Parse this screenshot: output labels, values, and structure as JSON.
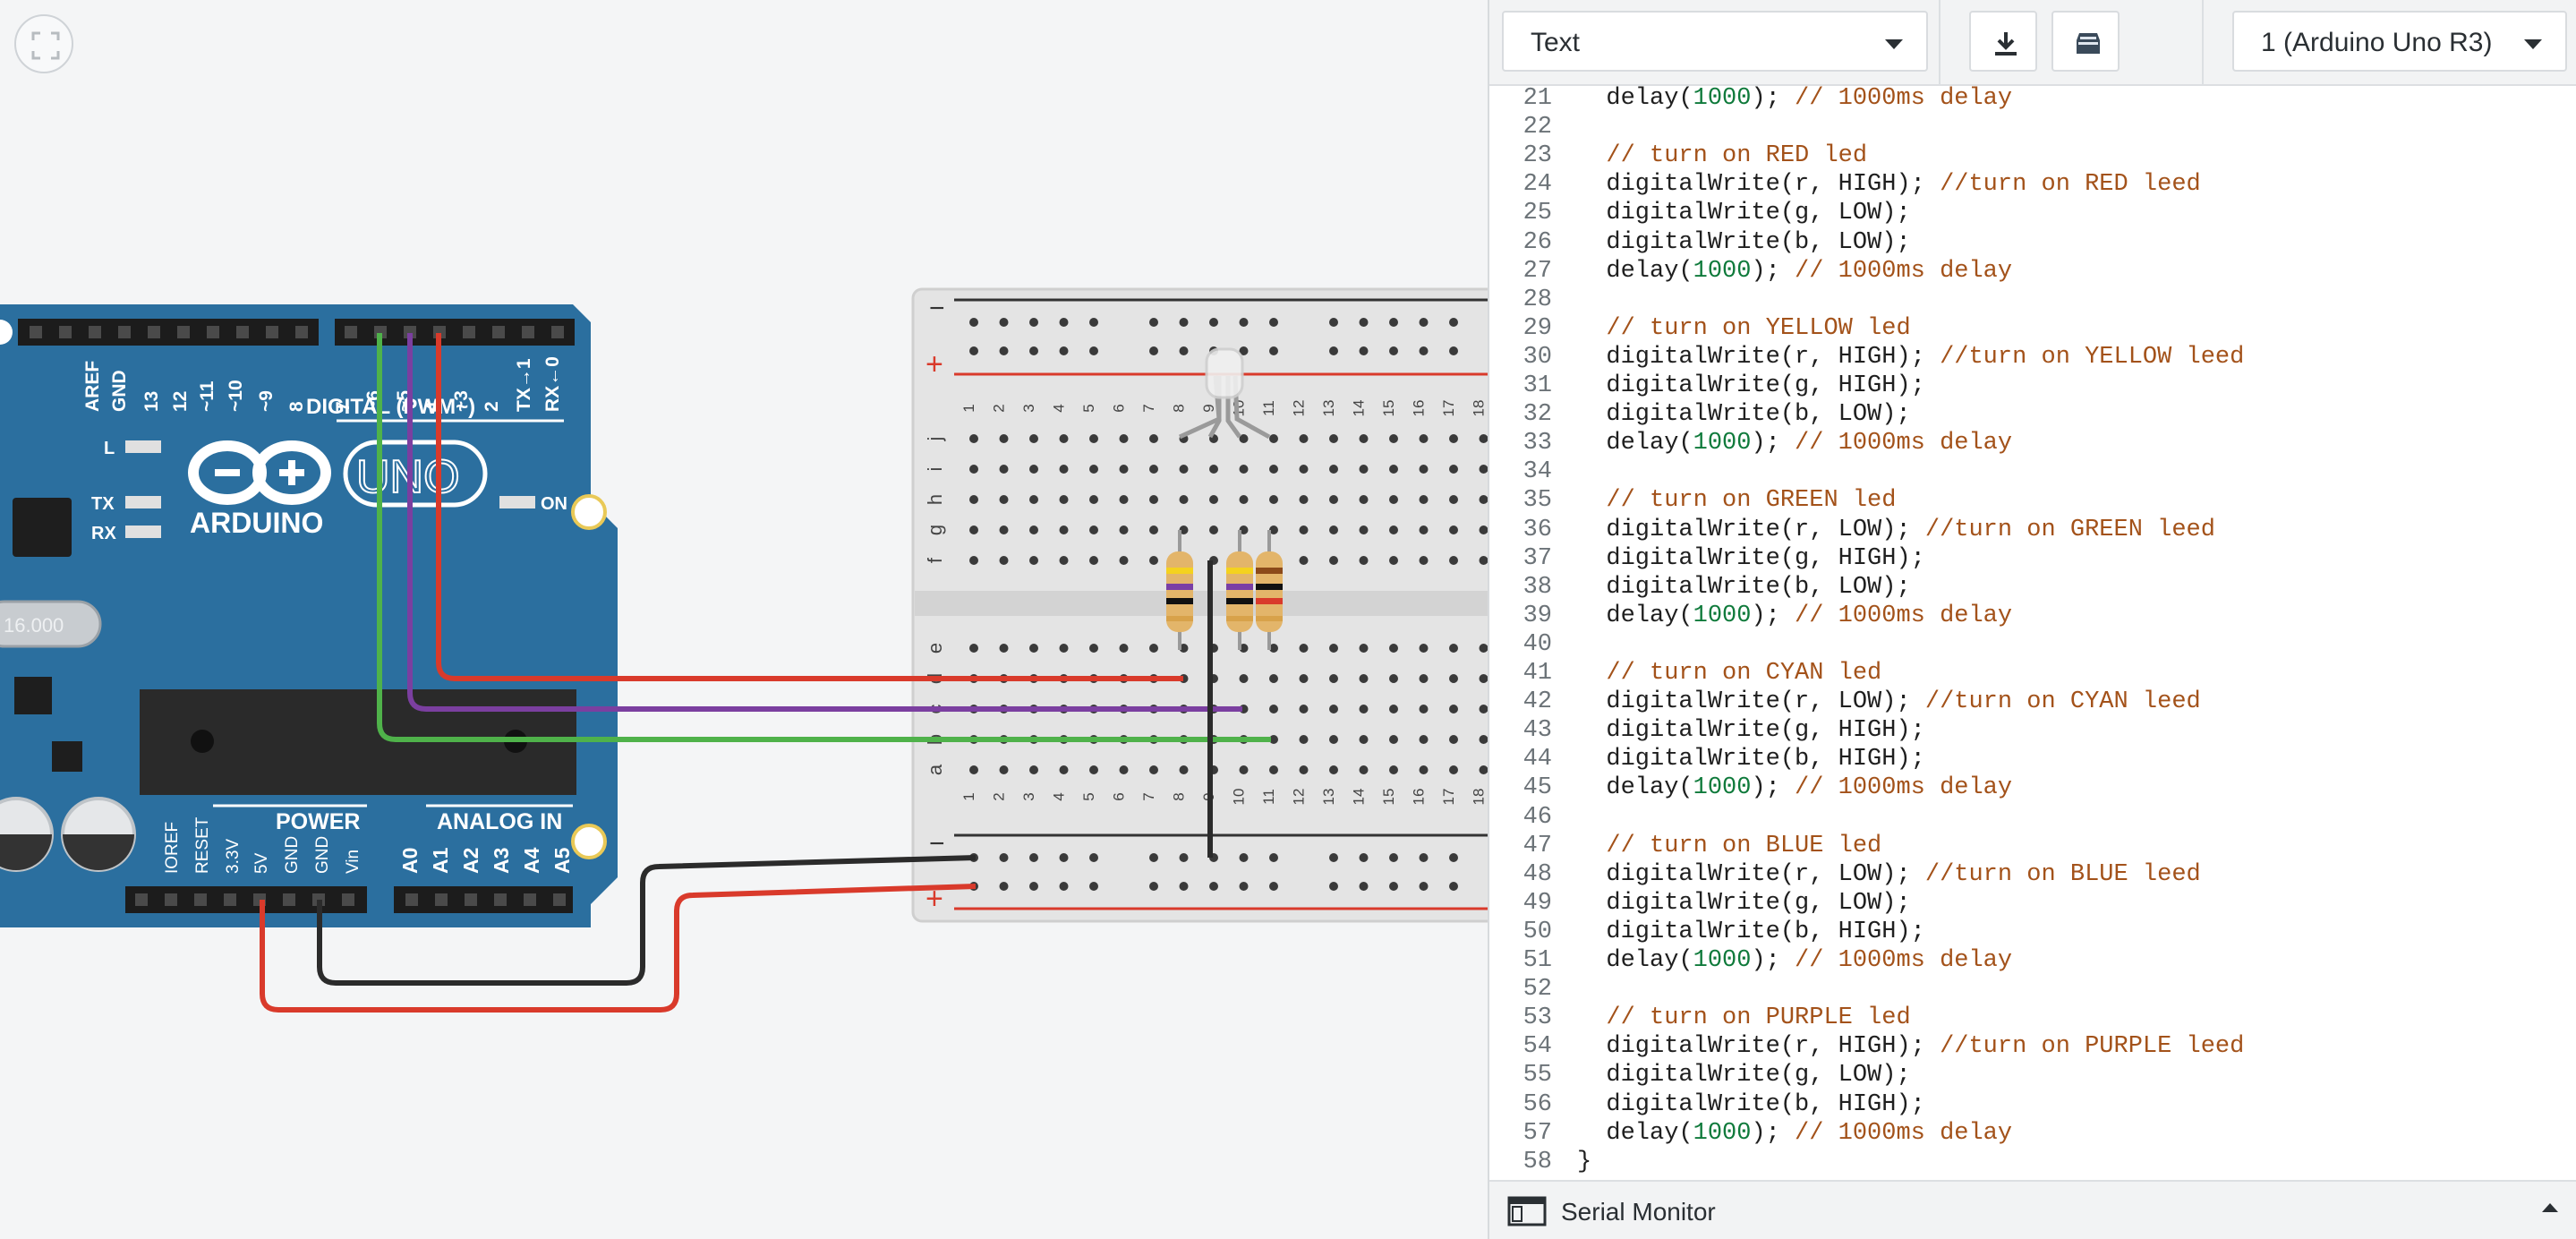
{
  "canvas": {
    "board": {
      "digital_header": [
        "AREF",
        "GND",
        "13",
        "12",
        "~11",
        "~10",
        "~9",
        "8",
        "7",
        "~6",
        "~5",
        "4",
        "~3",
        "2",
        "TX→1",
        "RX←0"
      ],
      "digital_label": "DIGITAL (PWM~)",
      "led_labels": [
        "L",
        "TX",
        "RX"
      ],
      "on_label": "ON",
      "brand": "ARDUINO",
      "model": "UNO",
      "crystal": "16.000",
      "power_label": "POWER",
      "analog_label": "ANALOG IN",
      "power_pins": [
        "IOREF",
        "RESET",
        "3.3V",
        "5V",
        "GND",
        "GND",
        "Vin"
      ],
      "analog_pins": [
        "A0",
        "A1",
        "A2",
        "A3",
        "A4",
        "A5"
      ]
    },
    "breadboard": {
      "rail_minus": "−",
      "rail_plus": "+",
      "row_letters_top": [
        "j",
        "i",
        "h",
        "g",
        "f"
      ],
      "row_letters_bottom": [
        "e",
        "d",
        "c",
        "b",
        "a"
      ],
      "column_numbers": [
        "1",
        "2",
        "3",
        "4",
        "5",
        "6",
        "7",
        "8",
        "9",
        "10",
        "11",
        "12",
        "13",
        "14",
        "15",
        "16",
        "17",
        "18"
      ]
    },
    "wire_colors": {
      "red": "#d93a2b",
      "purple": "#7b3fa0",
      "green": "#4fb24a",
      "black": "#2b2b2b"
    }
  },
  "toolbar": {
    "mode_select": "Text",
    "component_select": "1 (Arduino Uno R3)",
    "download_icon": "download-icon",
    "library_icon": "library-icon"
  },
  "code": {
    "lines": [
      {
        "n": "21",
        "parts": [
          [
            "",
            "  delay("
          ],
          [
            "num",
            "1000"
          ],
          [
            "",
            "); "
          ],
          [
            "cm",
            "// 1000ms delay"
          ]
        ]
      },
      {
        "n": "22",
        "parts": []
      },
      {
        "n": "23",
        "parts": [
          [
            "cm",
            "  // turn on RED led"
          ]
        ]
      },
      {
        "n": "24",
        "parts": [
          [
            "",
            "  digitalWrite(r, HIGH); "
          ],
          [
            "cm",
            "//turn on RED leed"
          ]
        ]
      },
      {
        "n": "25",
        "parts": [
          [
            "",
            "  digitalWrite(g, LOW);"
          ]
        ]
      },
      {
        "n": "26",
        "parts": [
          [
            "",
            "  digitalWrite(b, LOW);"
          ]
        ]
      },
      {
        "n": "27",
        "parts": [
          [
            "",
            "  delay("
          ],
          [
            "num",
            "1000"
          ],
          [
            "",
            "); "
          ],
          [
            "cm",
            "// 1000ms delay"
          ]
        ]
      },
      {
        "n": "28",
        "parts": []
      },
      {
        "n": "29",
        "parts": [
          [
            "cm",
            "  // turn on YELLOW led"
          ]
        ]
      },
      {
        "n": "30",
        "parts": [
          [
            "",
            "  digitalWrite(r, HIGH); "
          ],
          [
            "cm",
            "//turn on YELLOW leed"
          ]
        ]
      },
      {
        "n": "31",
        "parts": [
          [
            "",
            "  digitalWrite(g, HIGH);"
          ]
        ]
      },
      {
        "n": "32",
        "parts": [
          [
            "",
            "  digitalWrite(b, LOW);"
          ]
        ]
      },
      {
        "n": "33",
        "parts": [
          [
            "",
            "  delay("
          ],
          [
            "num",
            "1000"
          ],
          [
            "",
            "); "
          ],
          [
            "cm",
            "// 1000ms delay"
          ]
        ]
      },
      {
        "n": "34",
        "parts": []
      },
      {
        "n": "35",
        "parts": [
          [
            "cm",
            "  // turn on GREEN led"
          ]
        ]
      },
      {
        "n": "36",
        "parts": [
          [
            "",
            "  digitalWrite(r, LOW); "
          ],
          [
            "cm",
            "//turn on GREEN leed"
          ]
        ]
      },
      {
        "n": "37",
        "parts": [
          [
            "",
            "  digitalWrite(g, HIGH);"
          ]
        ]
      },
      {
        "n": "38",
        "parts": [
          [
            "",
            "  digitalWrite(b, LOW);"
          ]
        ]
      },
      {
        "n": "39",
        "parts": [
          [
            "",
            "  delay("
          ],
          [
            "num",
            "1000"
          ],
          [
            "",
            "); "
          ],
          [
            "cm",
            "// 1000ms delay"
          ]
        ]
      },
      {
        "n": "40",
        "parts": []
      },
      {
        "n": "41",
        "parts": [
          [
            "cm",
            "  // turn on CYAN led"
          ]
        ]
      },
      {
        "n": "42",
        "parts": [
          [
            "",
            "  digitalWrite(r, LOW); "
          ],
          [
            "cm",
            "//turn on CYAN leed"
          ]
        ]
      },
      {
        "n": "43",
        "parts": [
          [
            "",
            "  digitalWrite(g, HIGH);"
          ]
        ]
      },
      {
        "n": "44",
        "parts": [
          [
            "",
            "  digitalWrite(b, HIGH);"
          ]
        ]
      },
      {
        "n": "45",
        "parts": [
          [
            "",
            "  delay("
          ],
          [
            "num",
            "1000"
          ],
          [
            "",
            "); "
          ],
          [
            "cm",
            "// 1000ms delay"
          ]
        ]
      },
      {
        "n": "46",
        "parts": []
      },
      {
        "n": "47",
        "parts": [
          [
            "cm",
            "  // turn on BLUE led"
          ]
        ]
      },
      {
        "n": "48",
        "parts": [
          [
            "",
            "  digitalWrite(r, LOW); "
          ],
          [
            "cm",
            "//turn on BLUE leed"
          ]
        ]
      },
      {
        "n": "49",
        "parts": [
          [
            "",
            "  digitalWrite(g, LOW);"
          ]
        ]
      },
      {
        "n": "50",
        "parts": [
          [
            "",
            "  digitalWrite(b, HIGH);"
          ]
        ]
      },
      {
        "n": "51",
        "parts": [
          [
            "",
            "  delay("
          ],
          [
            "num",
            "1000"
          ],
          [
            "",
            "); "
          ],
          [
            "cm",
            "// 1000ms delay"
          ]
        ]
      },
      {
        "n": "52",
        "parts": []
      },
      {
        "n": "53",
        "parts": [
          [
            "cm",
            "  // turn on PURPLE led"
          ]
        ]
      },
      {
        "n": "54",
        "parts": [
          [
            "",
            "  digitalWrite(r, HIGH); "
          ],
          [
            "cm",
            "//turn on PURPLE leed"
          ]
        ]
      },
      {
        "n": "55",
        "parts": [
          [
            "",
            "  digitalWrite(g, LOW);"
          ]
        ]
      },
      {
        "n": "56",
        "parts": [
          [
            "",
            "  digitalWrite(b, HIGH);"
          ]
        ]
      },
      {
        "n": "57",
        "parts": [
          [
            "",
            "  delay("
          ],
          [
            "num",
            "1000"
          ],
          [
            "",
            "); "
          ],
          [
            "cm",
            "// 1000ms delay"
          ]
        ]
      },
      {
        "n": "58",
        "parts": [
          [
            "",
            "}"
          ]
        ]
      }
    ]
  },
  "serial_monitor": {
    "label": "Serial Monitor"
  }
}
